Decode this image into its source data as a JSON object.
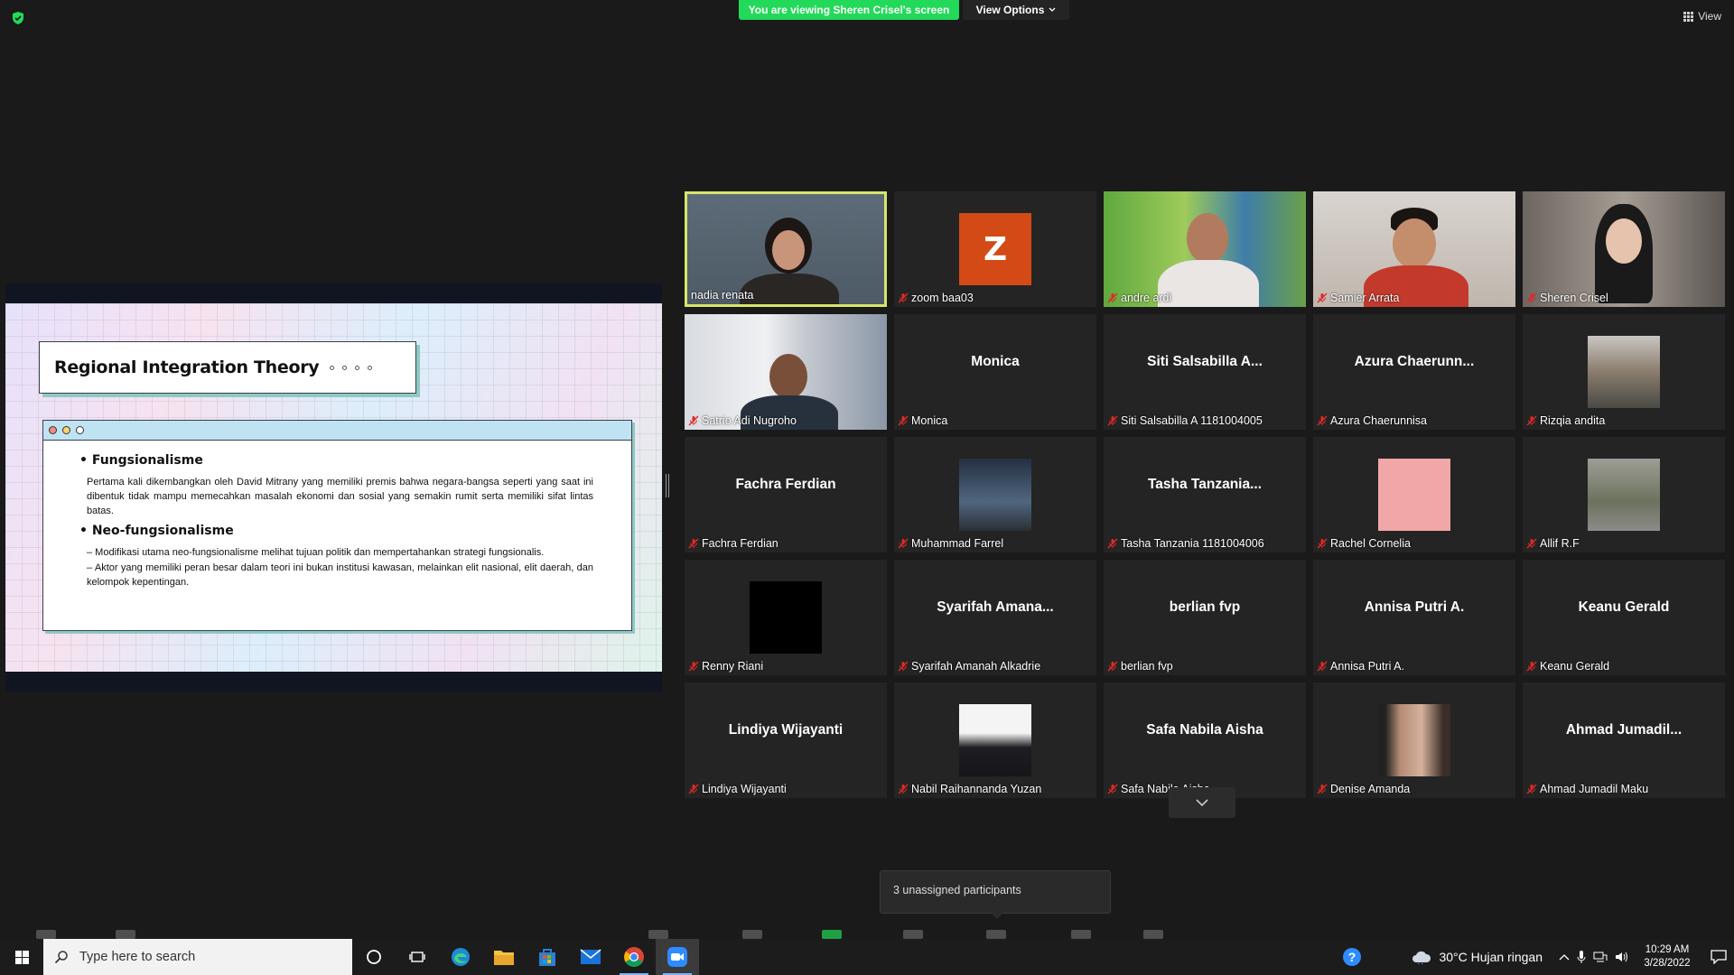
{
  "meeting": {
    "viewing_banner": "You are viewing Sheren Crisel's screen",
    "view_options": "View Options",
    "view_label": "View"
  },
  "slide": {
    "title": "Regional Integration Theory",
    "sections": [
      {
        "heading": "• Fungsionalisme",
        "paragraphs": [
          "Pertama kali dikembangkan oleh David Mitrany yang memiliki premis bahwa negara-bangsa seperti yang saat ini dibentuk tidak mampu memecahkan masalah ekonomi dan sosial yang semakin rumit serta memiliki sifat lintas batas."
        ]
      },
      {
        "heading": "• Neo-fungsionalisme",
        "paragraphs": [
          "– Modifikasi utama neo-fungsionalisme melihat tujuan politik dan mempertahankan strategi fungsionalis.",
          "– Aktor yang memiliki peran besar dalam teori ini bukan institusi kawasan, melainkan elit nasional, elit daerah, dan kelompok kepentingan."
        ]
      }
    ]
  },
  "participants": [
    {
      "name": "nadia renata",
      "type": "video",
      "active": true,
      "muted": false
    },
    {
      "name": "zoom baa03",
      "type": "avatar-letter",
      "letter": "Z",
      "muted": true
    },
    {
      "name": "andre ardi",
      "type": "video",
      "muted": true
    },
    {
      "name": "Samier Arrata",
      "type": "video",
      "muted": true
    },
    {
      "name": "Sheren Crisel",
      "type": "video",
      "muted": true
    },
    {
      "name": "Satrio Adi Nugroho",
      "type": "video",
      "muted": true
    },
    {
      "name": "Monica",
      "display": "Monica",
      "type": "name",
      "muted": true
    },
    {
      "name": "Siti Salsabilla A 1181004005",
      "display": "Siti Salsabilla A...",
      "type": "name",
      "muted": true
    },
    {
      "name": "Azura Chaerunnisa",
      "display": "Azura  Chaerunn...",
      "type": "name",
      "muted": true
    },
    {
      "name": "Rizqia andita",
      "type": "photo",
      "muted": true
    },
    {
      "name": "Fachra Ferdian",
      "display": "Fachra Ferdian",
      "type": "name",
      "muted": true
    },
    {
      "name": "Muhammad Farrel",
      "type": "photo",
      "muted": true
    },
    {
      "name": "Tasha Tanzania 1181004006",
      "display": "Tasha  Tanzania...",
      "type": "name",
      "muted": true
    },
    {
      "name": "Rachel Cornelia",
      "type": "photo-pink",
      "muted": true
    },
    {
      "name": "Allif R.F",
      "type": "photo",
      "muted": true
    },
    {
      "name": "Renny Riani",
      "type": "photo-black",
      "muted": true
    },
    {
      "name": "Syarifah Amanah Alkadrie",
      "display": "Syarifah  Amana...",
      "type": "name",
      "muted": true
    },
    {
      "name": "berlian fvp",
      "display": "berlian fvp",
      "type": "name",
      "muted": true
    },
    {
      "name": "Annisa Putri A.",
      "display": "Annisa Putri A.",
      "type": "name",
      "muted": true
    },
    {
      "name": "Keanu Gerald",
      "display": "Keanu Gerald",
      "type": "name",
      "muted": true
    },
    {
      "name": "Lindiya Wijayanti",
      "display": "Lindiya Wijayanti",
      "type": "name",
      "muted": true
    },
    {
      "name": "Nabil Raihannanda Yuzan",
      "type": "photo",
      "muted": true
    },
    {
      "name": "Safa Nabila Aisha",
      "display": "Safa Nabila Aisha",
      "type": "name",
      "muted": true
    },
    {
      "name": "Denise Amanda",
      "type": "photo",
      "muted": true
    },
    {
      "name": "Ahmad Jumadil Maku",
      "display": "Ahmad  Jumadil...",
      "type": "name",
      "muted": true
    }
  ],
  "tooltip": "3 unassigned participants",
  "taskbar": {
    "search_placeholder": "Type here to search",
    "weather": "30°C  Hujan ringan",
    "time": "10:29 AM",
    "date": "3/28/2022"
  },
  "colors": {
    "banner": "#23d959",
    "active_speaker_border": "#d7e66a",
    "mic_off": "#e02828",
    "zoom_avatar": "#d34a17"
  }
}
